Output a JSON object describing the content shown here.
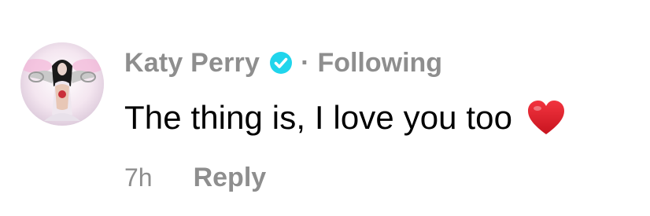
{
  "comment": {
    "author": "Katy Perry",
    "verified_icon": "verified-badge-icon",
    "separator": "·",
    "follow_status": "Following",
    "text": "The thing is, I love you too",
    "emoji": "red-heart-icon",
    "timestamp": "7h",
    "reply_label": "Reply"
  },
  "colors": {
    "muted": "#8e8e8e",
    "text": "#000000",
    "verified": "#20d5ec",
    "heart": "#e0202b"
  }
}
